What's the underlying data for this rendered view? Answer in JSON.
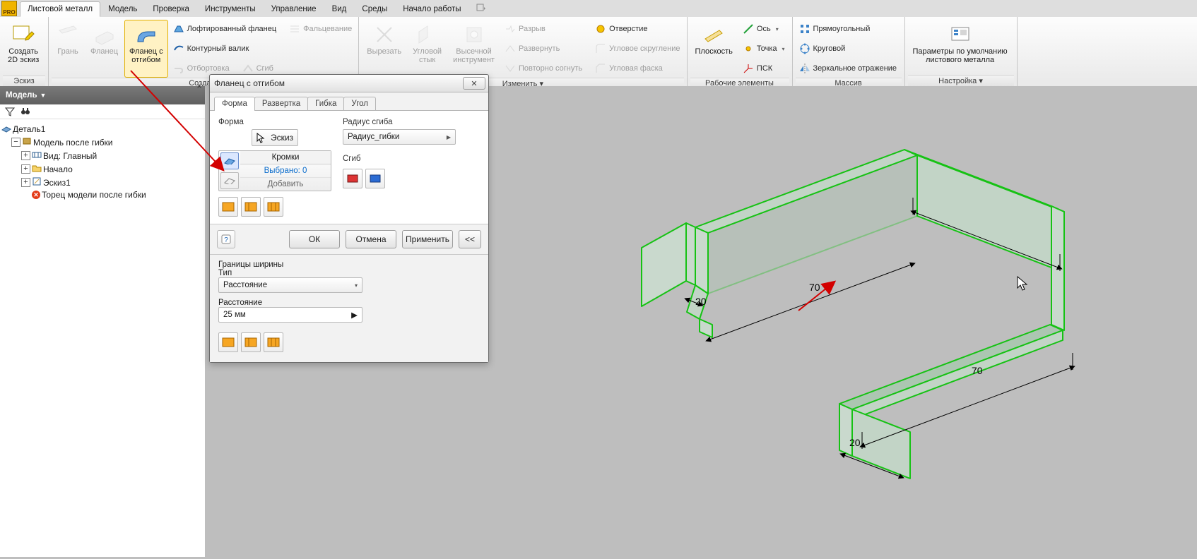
{
  "pro_badge": "PRO",
  "menubar": {
    "tabs": [
      {
        "label": "Листовой металл",
        "active": true
      },
      {
        "label": "Модель"
      },
      {
        "label": "Проверка"
      },
      {
        "label": "Инструменты"
      },
      {
        "label": "Управление"
      },
      {
        "label": "Вид"
      },
      {
        "label": "Среды"
      },
      {
        "label": "Начало работы"
      }
    ]
  },
  "ribbon": {
    "groups": [
      {
        "name": "Эскиз",
        "items_big": [
          {
            "label": "Создать\n2D эскиз",
            "icon": "sketch-icon"
          }
        ]
      },
      {
        "name": "Создать",
        "items_big": [
          {
            "label": "Грань",
            "icon": "face-icon",
            "dis": true
          },
          {
            "label": "Фланец",
            "icon": "flange-icon",
            "dis": true
          },
          {
            "label": "Фланец с\nотгибом",
            "icon": "bend-flange-icon",
            "sel": true
          }
        ],
        "col": [
          {
            "label": "Лофтированный фланец",
            "icon": "loft-icon"
          },
          {
            "label": "Контурный валик",
            "icon": "contour-icon"
          },
          {
            "label": "Отбортовка",
            "icon": "hem-icon",
            "dis": true
          },
          {
            "label": "Сгиб",
            "icon": "fold-icon",
            "dis": true
          }
        ],
        "col2": [
          {
            "label": "Фальцевание",
            "icon": "seam-icon",
            "dis": true
          }
        ]
      },
      {
        "name": "Изменить ▾",
        "items_big": [
          {
            "label": "Вырезать",
            "icon": "cut-icon",
            "dis": true
          },
          {
            "label": "Угловой\nстык",
            "icon": "corner-icon",
            "dis": true
          },
          {
            "label": "Высечной\nинструмент",
            "icon": "punch-icon",
            "dis": true
          }
        ],
        "col": [
          {
            "label": "Разрыв",
            "icon": "rip-icon",
            "dis": true
          },
          {
            "label": "Развернуть",
            "icon": "unfold-icon",
            "dis": true
          },
          {
            "label": "Повторно согнуть",
            "icon": "refold-icon",
            "dis": true
          }
        ],
        "col2": [
          {
            "label": "Отверстие",
            "icon": "hole-icon"
          },
          {
            "label": "Угловое скругление",
            "icon": "corner-round-icon",
            "dis": true
          },
          {
            "label": "Угловая фаска",
            "icon": "corner-chamfer-icon",
            "dis": true
          }
        ]
      },
      {
        "name": "Рабочие элементы",
        "items_big": [
          {
            "label": "Плоскость",
            "icon": "plane-icon"
          }
        ],
        "col": [
          {
            "label": "Ось",
            "icon": "axis-icon"
          },
          {
            "label": "Точка",
            "icon": "point-icon"
          },
          {
            "label": "ПСК",
            "icon": "ucs-icon"
          }
        ]
      },
      {
        "name": "Массив",
        "col": [
          {
            "label": "Прямоугольный",
            "icon": "rect-array-icon"
          },
          {
            "label": "Круговой",
            "icon": "circ-array-icon"
          },
          {
            "label": "Зеркальное отражение",
            "icon": "mirror-icon"
          }
        ]
      },
      {
        "name": "Настройка ▾",
        "items_big": [
          {
            "label": "Параметры по умолчанию\nлистового металла",
            "icon": "settings-icon"
          }
        ]
      }
    ]
  },
  "side": {
    "panel_title": "Модель",
    "part": "Деталь1",
    "tree": [
      {
        "label": "Модель после гибки",
        "level": 1,
        "icon": "model-icon",
        "exp": "-"
      },
      {
        "label": "Вид: Главный",
        "level": 2,
        "icon": "view-icon",
        "exp": "+"
      },
      {
        "label": "Начало",
        "level": 2,
        "icon": "folder-icon",
        "exp": "+"
      },
      {
        "label": "Эскиз1",
        "level": 2,
        "icon": "sketch-node-icon",
        "exp": "+"
      },
      {
        "label": "Торец модели после гибки",
        "level": 2,
        "icon": "end-icon"
      }
    ]
  },
  "dialog": {
    "title": "Фланец с отгибом",
    "tabs": [
      "Форма",
      "Развертка",
      "Гибка",
      "Угол"
    ],
    "body": {
      "shape_label": "Форма",
      "sketch_btn": "Эскиз",
      "edges_label": "Кромки",
      "selected": "Выбрано: 0",
      "add": "Добавить",
      "radius_label": "Радиус сгиба",
      "radius_value": "Радиус_гибки",
      "fold_label": "Сгиб"
    },
    "buttons": {
      "ok": "ОК",
      "cancel": "Отмена",
      "apply": "Применить",
      "expand": "<<"
    },
    "ext": {
      "title": "Границы ширины",
      "type_label": "Тип",
      "type_value": "Расстояние",
      "dist_label": "Расстояние",
      "dist_value": "25 мм"
    }
  },
  "canvas": {
    "dims": {
      "a": "70",
      "b": "70",
      "c": "20",
      "d": "20"
    }
  }
}
